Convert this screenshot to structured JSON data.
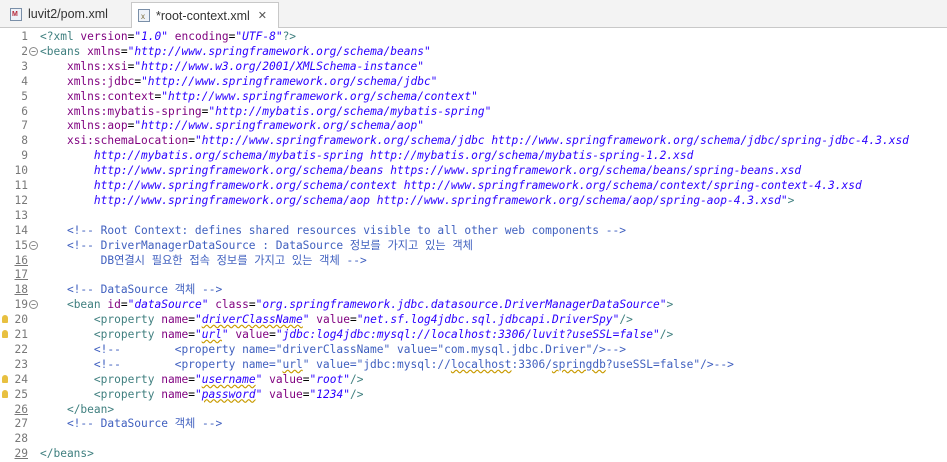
{
  "tabs": [
    {
      "label": "luvit2/pom.xml",
      "icon": "maven-xml-file-icon",
      "active": false
    },
    {
      "label": "*root-context.xml",
      "icon": "xml-file-icon",
      "active": true
    }
  ],
  "colors": {
    "tag": "#3f7f7f",
    "attr": "#7f007f",
    "string": "#2a00ff",
    "comment": "#3f5fbf"
  },
  "editor": {
    "lines": [
      {
        "n": "1",
        "parts": [
          [
            "tag",
            "<?xml "
          ],
          [
            "attr",
            "version"
          ],
          [
            "txt",
            "="
          ],
          [
            "str",
            "\"1.0\""
          ],
          [
            "txt",
            " "
          ],
          [
            "attr",
            "encoding"
          ],
          [
            "txt",
            "="
          ],
          [
            "str",
            "\"UTF-8\""
          ],
          [
            "tag",
            "?>"
          ]
        ]
      },
      {
        "n": "2",
        "fold": true,
        "parts": [
          [
            "tag",
            "<beans "
          ],
          [
            "attr",
            "xmlns"
          ],
          [
            "txt",
            "="
          ],
          [
            "str",
            "\"http://www.springframework.org/schema/beans\""
          ]
        ]
      },
      {
        "n": "3",
        "parts": [
          [
            "txt",
            "    "
          ],
          [
            "attr",
            "xmlns:xsi"
          ],
          [
            "txt",
            "="
          ],
          [
            "str",
            "\"http://www.w3.org/2001/XMLSchema-instance\""
          ]
        ]
      },
      {
        "n": "4",
        "parts": [
          [
            "txt",
            "    "
          ],
          [
            "attr",
            "xmlns:jdbc"
          ],
          [
            "txt",
            "="
          ],
          [
            "str",
            "\"http://www.springframework.org/schema/jdbc\""
          ]
        ]
      },
      {
        "n": "5",
        "parts": [
          [
            "txt",
            "    "
          ],
          [
            "attr",
            "xmlns:context"
          ],
          [
            "txt",
            "="
          ],
          [
            "str",
            "\"http://www.springframework.org/schema/context\""
          ]
        ]
      },
      {
        "n": "6",
        "parts": [
          [
            "txt",
            "    "
          ],
          [
            "attr",
            "xmlns:mybatis-spring"
          ],
          [
            "txt",
            "="
          ],
          [
            "str",
            "\"http://mybatis.org/schema/mybatis-spring\""
          ]
        ]
      },
      {
        "n": "7",
        "parts": [
          [
            "txt",
            "    "
          ],
          [
            "attr",
            "xmlns:aop"
          ],
          [
            "txt",
            "="
          ],
          [
            "str",
            "\"http://www.springframework.org/schema/aop\""
          ]
        ]
      },
      {
        "n": "8",
        "parts": [
          [
            "txt",
            "    "
          ],
          [
            "attr",
            "xsi:schemaLocation"
          ],
          [
            "txt",
            "="
          ],
          [
            "str",
            "\"http://www.springframework.org/schema/jdbc http://www.springframework.org/schema/jdbc/spring-jdbc-4.3.xsd"
          ]
        ]
      },
      {
        "n": "9",
        "parts": [
          [
            "str",
            "        http://mybatis.org/schema/mybatis-spring http://mybatis.org/schema/mybatis-spring-1.2.xsd"
          ]
        ]
      },
      {
        "n": "10",
        "parts": [
          [
            "str",
            "        http://www.springframework.org/schema/beans https://www.springframework.org/schema/beans/spring-beans.xsd"
          ]
        ]
      },
      {
        "n": "11",
        "parts": [
          [
            "str",
            "        http://www.springframework.org/schema/context http://www.springframework.org/schema/context/spring-context-4.3.xsd"
          ]
        ]
      },
      {
        "n": "12",
        "parts": [
          [
            "str",
            "        http://www.springframework.org/schema/aop http://www.springframework.org/schema/aop/spring-aop-4.3.xsd\""
          ],
          [
            "tag",
            ">"
          ]
        ]
      },
      {
        "n": "13",
        "parts": []
      },
      {
        "n": "14",
        "parts": [
          [
            "cmt",
            "    <!-- Root Context: defines shared resources visible to all other web components -->"
          ]
        ]
      },
      {
        "n": "15",
        "fold": true,
        "parts": [
          [
            "cmt",
            "    <!-- DriverManagerDataSource : DataSource 정보를 가지고 있는 객체"
          ]
        ]
      },
      {
        "n": "16",
        "ul": true,
        "parts": [
          [
            "cmt",
            "         DB연결시 필요한 접속 정보를 가지고 있는 객체 -->"
          ]
        ]
      },
      {
        "n": "17",
        "ul": true,
        "parts": []
      },
      {
        "n": "18",
        "ul": true,
        "parts": [
          [
            "cmt",
            "    <!-- DataSource 객체 -->"
          ]
        ]
      },
      {
        "n": "19",
        "fold": true,
        "parts": [
          [
            "txt",
            "    "
          ],
          [
            "tag",
            "<bean "
          ],
          [
            "attr",
            "id"
          ],
          [
            "txt",
            "="
          ],
          [
            "str",
            "\"dataSource\""
          ],
          [
            "txt",
            " "
          ],
          [
            "attr",
            "class"
          ],
          [
            "txt",
            "="
          ],
          [
            "str",
            "\"org.springframework.jdbc.datasource.DriverManagerDataSource\""
          ],
          [
            "tag",
            ">"
          ]
        ]
      },
      {
        "n": "20",
        "warn": true,
        "parts": [
          [
            "txt",
            "        "
          ],
          [
            "tag",
            "<property "
          ],
          [
            "attr",
            "name"
          ],
          [
            "txt",
            "="
          ],
          [
            "str",
            "\""
          ],
          [
            "strsq",
            "driverClassName"
          ],
          [
            "str",
            "\""
          ],
          [
            "txt",
            " "
          ],
          [
            "attr",
            "value"
          ],
          [
            "txt",
            "="
          ],
          [
            "str",
            "\"net.sf.log4jdbc.sql.jdbcapi.DriverSpy\""
          ],
          [
            "tag",
            "/>"
          ]
        ]
      },
      {
        "n": "21",
        "warn": true,
        "parts": [
          [
            "txt",
            "        "
          ],
          [
            "tag",
            "<property "
          ],
          [
            "attr",
            "name"
          ],
          [
            "txt",
            "="
          ],
          [
            "str",
            "\""
          ],
          [
            "strsq",
            "url"
          ],
          [
            "str",
            "\""
          ],
          [
            "txt",
            " "
          ],
          [
            "attr",
            "value"
          ],
          [
            "txt",
            "="
          ],
          [
            "str",
            "\"jdbc:log4jdbc:mysql://localhost:3306/luvit?useSSL=false\""
          ],
          [
            "tag",
            "/>"
          ]
        ]
      },
      {
        "n": "22",
        "parts": [
          [
            "cmt",
            "        <!--        <property name=\"driverClassName\" value=\"com.mysql.jdbc.Driver\"/>-->"
          ]
        ]
      },
      {
        "n": "23",
        "parts": [
          [
            "cmt",
            "        <!--        <property name=\""
          ],
          [
            "cmtsq",
            "url"
          ],
          [
            "cmt",
            "\" value=\"jdbc:mysql://"
          ],
          [
            "cmtsq",
            "localhost"
          ],
          [
            "cmt",
            ":3306/"
          ],
          [
            "cmtsq",
            "springdb"
          ],
          [
            "cmt",
            "?useSSL=false\"/>-->"
          ]
        ]
      },
      {
        "n": "24",
        "warn": true,
        "parts": [
          [
            "txt",
            "        "
          ],
          [
            "tag",
            "<property "
          ],
          [
            "attr",
            "name"
          ],
          [
            "txt",
            "="
          ],
          [
            "str",
            "\""
          ],
          [
            "strsq",
            "username"
          ],
          [
            "str",
            "\""
          ],
          [
            "txt",
            " "
          ],
          [
            "attr",
            "value"
          ],
          [
            "txt",
            "="
          ],
          [
            "str",
            "\"root\""
          ],
          [
            "tag",
            "/>"
          ]
        ]
      },
      {
        "n": "25",
        "warn": true,
        "parts": [
          [
            "txt",
            "        "
          ],
          [
            "tag",
            "<property "
          ],
          [
            "attr",
            "name"
          ],
          [
            "txt",
            "="
          ],
          [
            "str",
            "\""
          ],
          [
            "strsq",
            "password"
          ],
          [
            "str",
            "\""
          ],
          [
            "txt",
            " "
          ],
          [
            "attr",
            "value"
          ],
          [
            "txt",
            "="
          ],
          [
            "str",
            "\"1234\""
          ],
          [
            "tag",
            "/>"
          ]
        ]
      },
      {
        "n": "26",
        "ul": true,
        "parts": [
          [
            "txt",
            "    "
          ],
          [
            "tag",
            "</bean>"
          ]
        ]
      },
      {
        "n": "27",
        "parts": [
          [
            "cmt",
            "    <!-- DataSource 객체 -->"
          ]
        ]
      },
      {
        "n": "28",
        "parts": []
      },
      {
        "n": "29",
        "ul": true,
        "parts": [
          [
            "tag",
            "</beans>"
          ]
        ]
      }
    ]
  }
}
